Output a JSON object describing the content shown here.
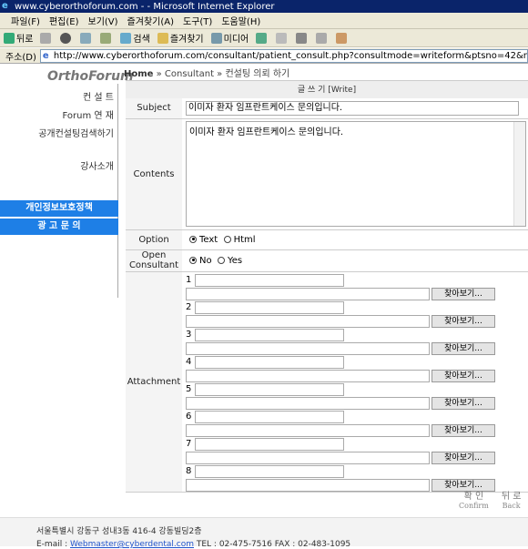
{
  "window": {
    "title": "www.cyberorthoforum.com - - Microsoft Internet Explorer"
  },
  "menu": [
    "파일(F)",
    "편집(E)",
    "보기(V)",
    "즐겨찾기(A)",
    "도구(T)",
    "도움말(H)"
  ],
  "toolbar": {
    "back": "뒤로",
    "search": "검색",
    "favorites": "즐겨찾기",
    "media": "미디어"
  },
  "address": {
    "label": "주소(D)",
    "url": "http://www.cyberorthoforum.com/consultant/patient_consult.php?consultmode=writeform&ptsno=42&n=12&p="
  },
  "logo": "OrthoForum",
  "sidebar": {
    "items": [
      "컨 설 트",
      "Forum 연 재",
      "공개컨설팅검색하기",
      "강사소개"
    ],
    "bars": [
      "개인정보보호정책",
      "광 고 문 의"
    ]
  },
  "breadcrumb": {
    "home": "Home",
    "rest": " » Consultant » 컨설팅 의뢰 하기"
  },
  "form": {
    "header": "글 쓰 기 [Write]",
    "subject_label": "Subject",
    "subject_value": "이미자 환자 임프란트케이스 문의입니다.",
    "contents_label": "Contents",
    "contents_value": "이미자 환자 임프란트케이스 문의입니다.",
    "option_label": "Option",
    "option_text": "Text",
    "option_html": "Html",
    "open_label": "Open Consultant",
    "open_no": "No",
    "open_yes": "Yes",
    "attachment_label": "Attachment",
    "attachments": [
      "1 :",
      "2 :",
      "3 :",
      "4 :",
      "5 :",
      "6 :",
      "7 :",
      "8 :"
    ],
    "browse": "찾아보기..."
  },
  "actions": {
    "confirm": "확 인",
    "confirm_en": "Confirm",
    "back": "뒤 로",
    "back_en": "Back"
  },
  "footer": {
    "address": "서울특별시 강동구 성내3동 416-4 강동빌딩2층",
    "email_prefix": "E-mail : ",
    "email": "Webmaster@cyberdental.com",
    "phone": " TEL : 02-475-7516  FAX : 02-483-1095"
  }
}
